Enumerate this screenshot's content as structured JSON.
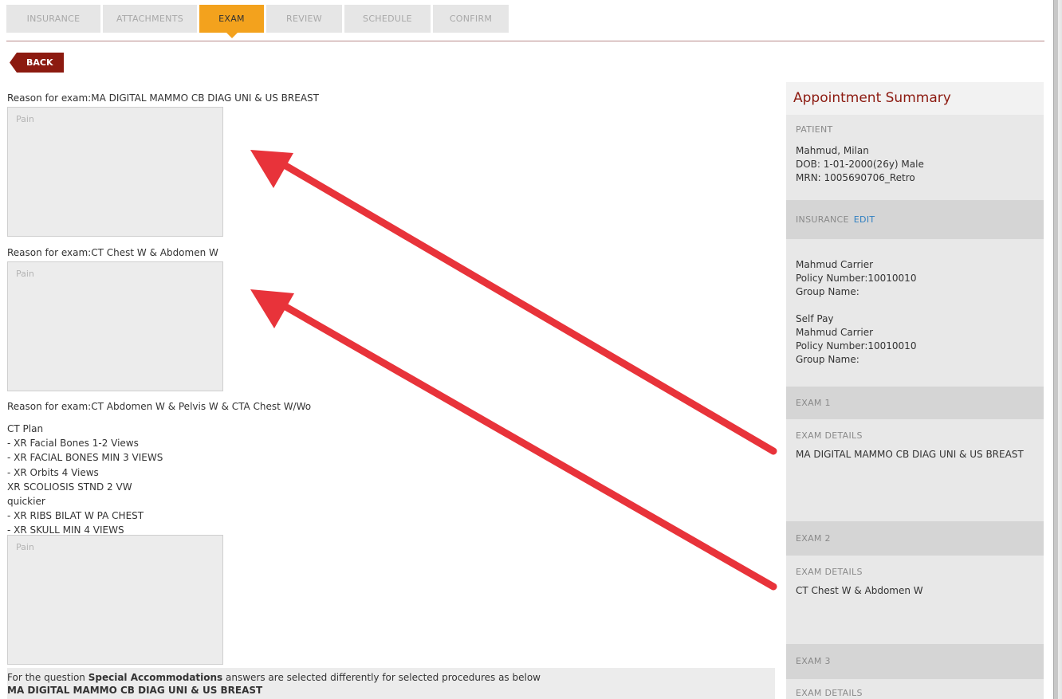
{
  "tabs": [
    {
      "label": "INSURANCE"
    },
    {
      "label": "ATTACHMENTS"
    },
    {
      "label": "EXAM"
    },
    {
      "label": "REVIEW"
    },
    {
      "label": "SCHEDULE"
    },
    {
      "label": "CONFIRM"
    }
  ],
  "active_tab": "EXAM",
  "back_label": "BACK",
  "exams": [
    {
      "reason": "Reason for exam:MA DIGITAL MAMMO CB DIAG UNI & US BREAST",
      "placeholder": "Pain"
    },
    {
      "reason": "Reason for exam:CT Chest W & Abdomen W",
      "placeholder": "Pain"
    },
    {
      "reason": "Reason for exam:CT Abdomen W & Pelvis W & CTA Chest W/Wo",
      "placeholder": "Pain"
    }
  ],
  "procedure_list": [
    "CT Plan",
    "- XR Facial Bones 1-2 Views",
    "- XR FACIAL BONES MIN 3 VIEWS",
    "- XR Orbits 4 Views",
    "XR SCOLIOSIS STND 2 VW",
    "quickier",
    "- XR RIBS BILAT W PA CHEST",
    "- XR SKULL MIN 4 VIEWS"
  ],
  "special": {
    "prefix": "For the question ",
    "question": "Special Accommodations",
    "suffix": " answers are selected differently for selected procedures as below",
    "procedure": "MA DIGITAL MAMMO CB DIAG UNI & US BREAST"
  },
  "summary": {
    "title": "Appointment Summary",
    "patient_label": "PATIENT",
    "patient_name": "Mahmud, Milan",
    "patient_dob": "DOB: 1-01-2000(26y) Male",
    "patient_mrn": "MRN: 1005690706_Retro",
    "insurance_label": "INSURANCE",
    "insurance_edit": "EDIT",
    "insurance_1": [
      "Mahmud Carrier",
      "Policy Number:10010010",
      "Group Name:"
    ],
    "insurance_2": [
      "Self Pay",
      "Mahmud Carrier",
      "Policy Number:10010010",
      "Group Name:"
    ],
    "exam1_label": "EXAM 1",
    "exam1_details_label": "EXAM DETAILS",
    "exam1_details": "MA DIGITAL MAMMO CB DIAG UNI & US BREAST",
    "exam2_label": "EXAM 2",
    "exam2_details_label": "EXAM DETAILS",
    "exam2_details": "CT Chest W & Abdomen W",
    "exam3_label": "EXAM 3",
    "exam3_details_label": "EXAM DETAILS"
  },
  "colors": {
    "accent": "#f3a21d",
    "brand": "#8c1a10",
    "link": "#2f7fc1",
    "arrow": "#e8333a"
  }
}
